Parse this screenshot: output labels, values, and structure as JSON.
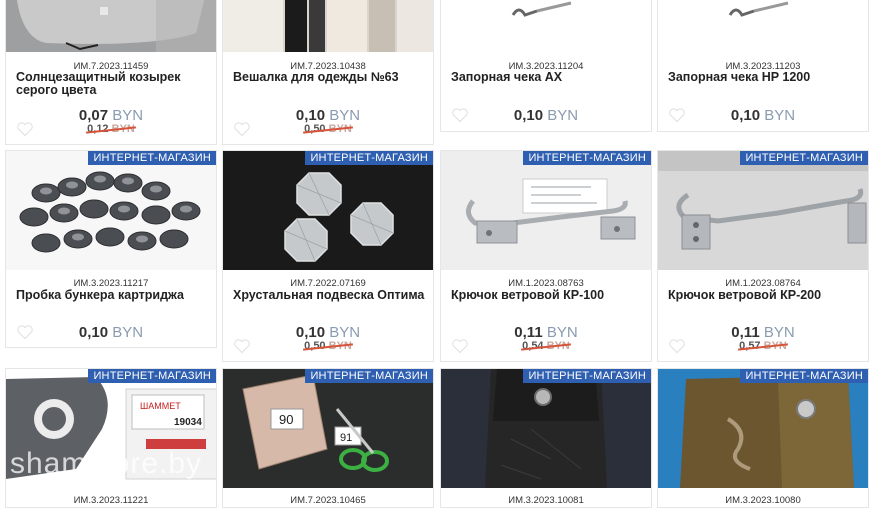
{
  "badge_label": "ИНТЕРНЕТ-МАГАЗИН",
  "currency": "BYN",
  "watermark": "shamstore.by",
  "products": [
    {
      "code": "ИМ.7.2023.11459",
      "title": "Солнцезащитный козырек серого цвета",
      "price": "0,07",
      "old_price": "0,12"
    },
    {
      "code": "ИМ.7.2023.10438",
      "title": "Вешалка для одежды №63",
      "price": "0,10",
      "old_price": "0,50"
    },
    {
      "code": "ИМ.3.2023.11204",
      "title": "Запорная чека AX",
      "price": "0,10",
      "old_price": ""
    },
    {
      "code": "ИМ.3.2023.11203",
      "title": "Запорная чека HP 1200",
      "price": "0,10",
      "old_price": ""
    },
    {
      "code": "ИМ.3.2023.11217",
      "title": "Пробка бункера картриджа",
      "price": "0,10",
      "old_price": ""
    },
    {
      "code": "ИМ.7.2022.07169",
      "title": "Хрустальная подвеска Оптима",
      "price": "0,10",
      "old_price": "0,50"
    },
    {
      "code": "ИМ.1.2023.08763",
      "title": "Крючок ветровой КР-100",
      "price": "0,11",
      "old_price": "0,54"
    },
    {
      "code": "ИМ.1.2023.08764",
      "title": "Крючок ветровой КР-200",
      "price": "0,11",
      "old_price": "0,57"
    },
    {
      "code": "ИМ.3.2023.11221",
      "title": "",
      "price": "",
      "old_price": ""
    },
    {
      "code": "ИМ.7.2023.10465",
      "title": "",
      "price": "",
      "old_price": ""
    },
    {
      "code": "ИМ.3.2023.10081",
      "title": "",
      "price": "",
      "old_price": ""
    },
    {
      "code": "ИМ.3.2023.10080",
      "title": "",
      "price": "",
      "old_price": ""
    }
  ],
  "photo_labels": {
    "sticker_brand": "ШАММЕТ",
    "sticker_number": "19034",
    "tag_a": "90",
    "tag_b": "91"
  },
  "colors": {
    "badge": "#2f5fb0",
    "strike": "#d6543a",
    "currency": "#8a9bb0"
  }
}
